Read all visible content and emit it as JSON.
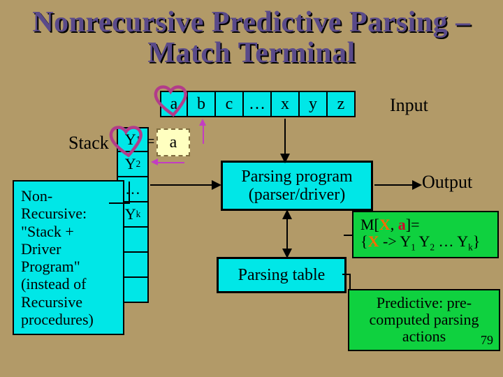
{
  "title": "Nonrecursive Predictive Parsing – Match Terminal",
  "tape": {
    "cells": [
      "a",
      "b",
      "c",
      "…",
      "x",
      "y",
      "z"
    ]
  },
  "labels": {
    "input": "Input",
    "stack": "Stack",
    "output": "Output",
    "dashedA": "a",
    "eq": "="
  },
  "stack": {
    "cells": [
      "Y1",
      "Y2",
      "…",
      "Yk",
      "",
      "",
      ""
    ]
  },
  "callout": "Non-Recursive: \"Stack + Driver Program\" (instead of Recursive procedures)",
  "prog": {
    "line1": "Parsing program",
    "line2": "(parser/driver)"
  },
  "ptable": "Parsing table",
  "rule": {
    "prefix": "M[",
    "X": "X",
    "mid": ", ",
    "a": "a",
    "suffix": "]=",
    "prod_l": "{",
    "prod_x": "X",
    "prod_arrow": " -> Y",
    "prod_tail1": "1",
    "prod_y2": " Y",
    "prod_tail2": "2",
    "prod_dots": " …",
    "prod_yk": " Y",
    "prod_tailk": "k",
    "prod_r": "}"
  },
  "predictive": "Predictive: pre-computed parsing actions",
  "page": "79"
}
